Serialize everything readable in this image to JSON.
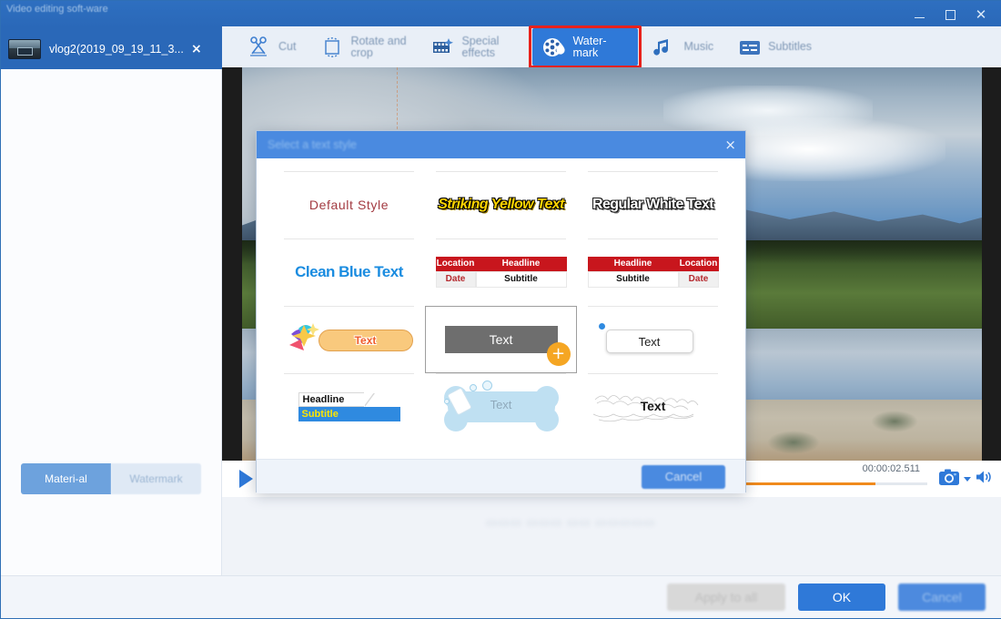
{
  "window": {
    "app_title": "Video editing soft-ware",
    "minimize_label": "Minimize",
    "maximize_label": "Maximize",
    "close_label": "Close"
  },
  "file_tab": {
    "name": "vlog2(2019_09_19_11_3...",
    "close_label": "×",
    "thumbnail_icon": "video-thumbnail"
  },
  "toolbar": {
    "items": [
      {
        "label": "Cut",
        "icon": "scissors-icon",
        "active": false
      },
      {
        "label": "Rotate and crop",
        "icon": "crop-icon",
        "active": false
      },
      {
        "label": "Special effects",
        "icon": "film-sparkle-icon",
        "active": false
      },
      {
        "label": "Water-mark",
        "icon": "watermark-film-drop-icon",
        "active": true
      },
      {
        "label": "Music",
        "icon": "music-note-icon",
        "active": false
      },
      {
        "label": "Subtitles",
        "icon": "subtitles-icon",
        "active": false
      }
    ],
    "highlight_color": "#e8211b",
    "active_color": "#2f79d8"
  },
  "left_panel": {
    "tabs": [
      {
        "label": "Materi-al",
        "selected": true
      },
      {
        "label": "Watermark",
        "selected": false
      }
    ]
  },
  "player": {
    "play_icon": "play-icon",
    "timestamp": "00:00:02.511",
    "progress_percent": 92,
    "progress_color": "#f08a1c",
    "snapshot_icon": "camera-icon",
    "snapshot_caret_icon": "chevron-down-icon",
    "volume_icon": "speaker-icon"
  },
  "bottom_bar": {
    "apply_all_label": "Apply to all",
    "ok_label": "OK",
    "cancel_label": "Cancel"
  },
  "dialog": {
    "title": "Select a text style",
    "close_label": "×",
    "cancel_label": "Cancel",
    "styles": [
      {
        "id": "default-style",
        "kind": "plain",
        "text": "Default Style",
        "color": "#a33b42",
        "selected": false
      },
      {
        "id": "striking-yellow-text",
        "kind": "plain",
        "text": "Striking Yellow Text",
        "color": "#ffd400",
        "selected": false
      },
      {
        "id": "regular-white-text",
        "kind": "plain",
        "text": "Regular White Text",
        "color": "#ffffff",
        "selected": false
      },
      {
        "id": "clean-blue-text",
        "kind": "plain",
        "text": "Clean Blue Text",
        "color": "#1a8ce0",
        "selected": false
      },
      {
        "id": "news-banner-left",
        "kind": "banner",
        "location": "Location",
        "headline": "Headline",
        "date": "Date",
        "subtitle": "Subtitle",
        "color": "#c8161d",
        "selected": false
      },
      {
        "id": "news-banner-right",
        "kind": "banner",
        "location": "Location",
        "headline": "Headline",
        "date": "Date",
        "subtitle": "Subtitle",
        "color": "#c8161d",
        "selected": false
      },
      {
        "id": "orange-ribbon-text",
        "kind": "ribbon",
        "text": "Text",
        "color": "#f9c97d",
        "selected": false
      },
      {
        "id": "grey-box-text",
        "kind": "greybox",
        "text": "Text",
        "color": "#6e6e6e",
        "add_label": "+",
        "selected": true
      },
      {
        "id": "bubble-callout-text",
        "kind": "bubble",
        "text": "Text",
        "color": "#ffffff",
        "selected": false
      },
      {
        "id": "headline-subtitle-blue",
        "kind": "headsub",
        "headline": "Headline",
        "subtitle": "Subtitle",
        "color": "#2f8ae0",
        "selected": false
      },
      {
        "id": "bone-bubble-text",
        "kind": "bone",
        "text": "Text",
        "color": "#bfe0f2",
        "selected": false
      },
      {
        "id": "scribble-text",
        "kind": "scribble",
        "text": "Text",
        "color": "#1a1a1a",
        "selected": false
      }
    ]
  }
}
